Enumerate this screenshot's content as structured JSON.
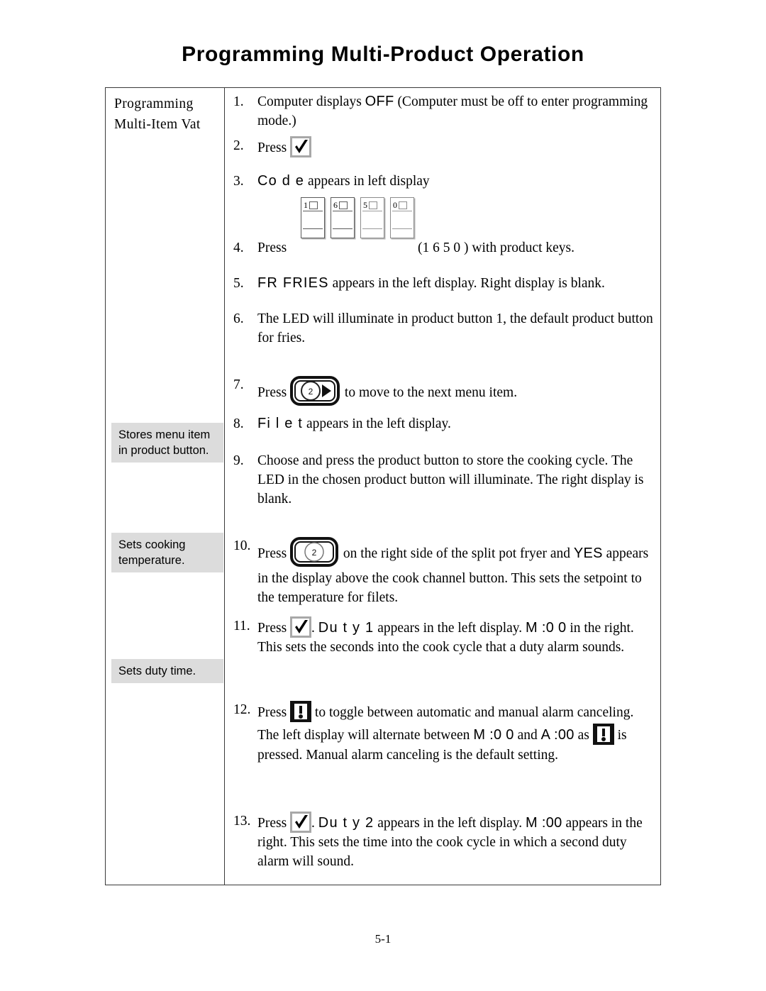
{
  "document": {
    "title": "Programming Multi-Product Operation",
    "page_number": "5-1"
  },
  "table": {
    "left_column": {
      "header_line1": "Programming",
      "header_line2": "Multi-Item Vat",
      "callouts": [
        {
          "line1": "Stores menu item",
          "line2": "in product button."
        },
        {
          "line1": "Sets cooking",
          "line2": "temperature."
        },
        {
          "line1": "Sets duty time.",
          "line2": ""
        }
      ]
    },
    "steps": [
      {
        "num": "1.",
        "pre": "Computer displays ",
        "display": "OFF",
        "post": "  (Computer must be off to enter programming mode.)"
      },
      {
        "num": "2.",
        "pre": "Press ",
        "icon": "checkmark-button-icon",
        "post": ""
      },
      {
        "num": "3.",
        "display": "Co d e",
        "post": " appears in left display"
      },
      {
        "num": "4.",
        "pre": "Press ",
        "icon": "product-keys-1650",
        "post": "(1 6 5 0 ) with product keys.",
        "keys": [
          "1",
          "6",
          "5",
          "0"
        ],
        "code": "1650"
      },
      {
        "num": "5.",
        "display": "FR  FRIES",
        "post": " appears in the left display. Right display is blank."
      },
      {
        "num": "6.",
        "post": "The LED will illuminate in product button 1, the default product button for fries."
      },
      {
        "num": "7.",
        "pre": "Press ",
        "icon": "cook-channel-next-button-icon",
        "post": " to move to the next menu item."
      },
      {
        "num": "8.",
        "display": "Fi l e t",
        "post": "  appears in the left display."
      },
      {
        "num": "9.",
        "post": " Choose and press the product button to store the cooking cycle. The LED in the chosen product button will illuminate. The right display is blank."
      },
      {
        "num": "10.",
        "pre": "Press ",
        "icon": "cook-channel-button-icon",
        "mid": " on the right side of the split pot fryer and ",
        "display": "YES",
        "post": " appears in the display above the cook channel button. This sets the setpoint to the temperature for filets."
      },
      {
        "num": "11.",
        "pre": "Press ",
        "icon": "checkmark-button-icon",
        "mid": ". ",
        "display": "Du t y  1",
        "mid2": " appears in the left display. ",
        "display2": "M :0 0",
        "post": " in the right. This sets the seconds into the cook cycle that a duty alarm sounds."
      },
      {
        "num": "12.",
        "pre": "Press ",
        "icon": "alarm-button-icon",
        "mid": " to toggle between automatic and manual alarm canceling. The left display will alternate between ",
        "display": "M :0 0",
        "mid2": " and ",
        "display2": "A :00",
        "mid3": " as ",
        "icon2": "alarm-button-icon",
        "post": " is pressed. Manual alarm canceling is the default setting."
      },
      {
        "num": "13.",
        "pre": "Press ",
        "icon": "checkmark-button-icon",
        "mid": ". ",
        "display": "Du t y  2",
        "mid2": " appears in the left display. ",
        "display2": "M :00",
        "post": " appears in the right. This sets the time into the cook cycle in which a second duty alarm will sound."
      }
    ]
  }
}
